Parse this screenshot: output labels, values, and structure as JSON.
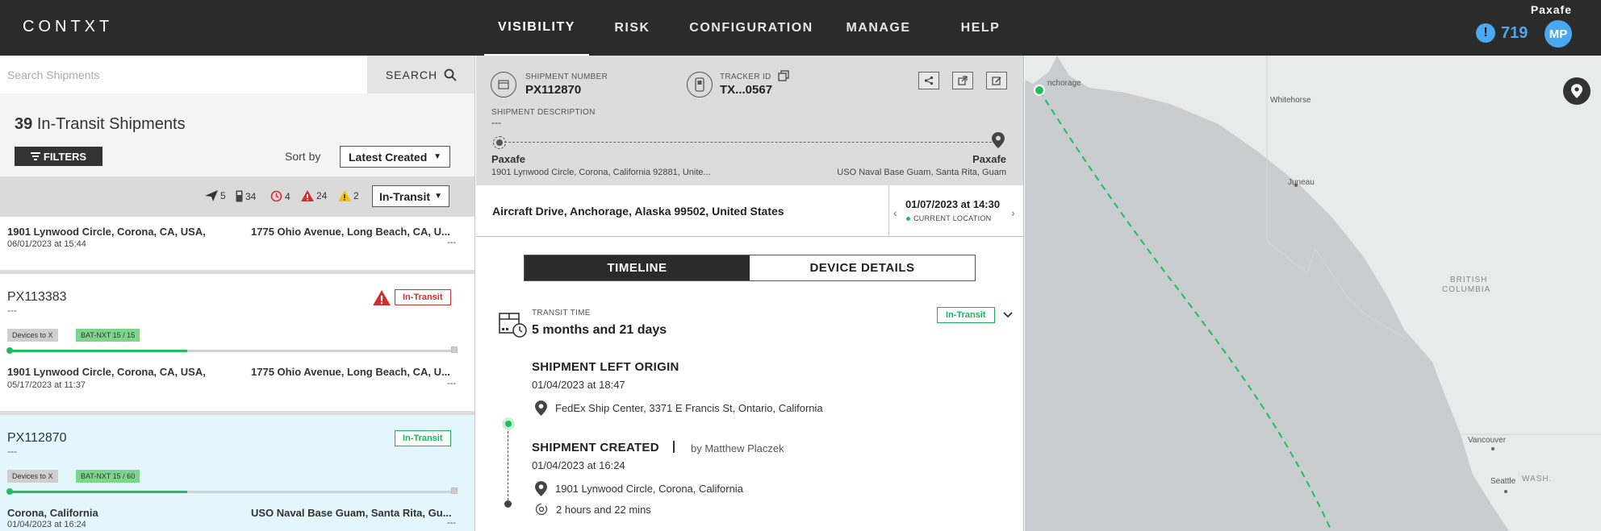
{
  "app": {
    "logo": "CONTXT",
    "org_name": "Paxafe",
    "alert_count": "719",
    "alert_icon": "exclamation-icon",
    "avatar_initials": "MP"
  },
  "nav": [
    {
      "label": "VISIBILITY",
      "active": true
    },
    {
      "label": "RISK",
      "active": false
    },
    {
      "label": "CONFIGURATION",
      "active": false
    },
    {
      "label": "MANAGE",
      "active": false
    },
    {
      "label": "HELP",
      "active": false
    }
  ],
  "search": {
    "placeholder": "Search Shipments",
    "button_label": "SEARCH"
  },
  "list": {
    "count": "39",
    "count_label": "In-Transit Shipments",
    "filters_label": "FILTERS",
    "sort_label": "Sort by",
    "sort_value": "Latest Created",
    "stats": {
      "in_flight": "5",
      "devices": "34",
      "late": "4",
      "alerts": "24",
      "warnings": "2"
    },
    "status_filter": "In-Transit",
    "cards": [
      {
        "origin": "1901 Lynwood Circle, Corona, CA, USA,",
        "destination": "1775 Ohio Avenue, Long Beach, CA, U...",
        "date": "06/01/2023 at 15:44",
        "dash": "---"
      },
      {
        "id": "PX113383",
        "desc": "---",
        "badge": "In-Transit",
        "chip1": "Devices to X",
        "chip2": "BAT-NXT 15 / 15",
        "progress": 0.4,
        "origin": "1901 Lynwood Circle, Corona, CA, USA,",
        "destination": "1775 Ohio Avenue, Long Beach, CA, U...",
        "date": "05/17/2023 at 11:37",
        "dash": "---"
      },
      {
        "id": "PX112870",
        "desc": "---",
        "badge": "In-Transit",
        "chip1": "Devices to X",
        "chip2": "BAT-NXT 15 / 60",
        "progress": 0.4,
        "origin": "Corona, California",
        "destination": "USO Naval Base Guam, Santa Rita, Gu...",
        "date": "01/04/2023 at 16:24",
        "dash": "---"
      }
    ]
  },
  "detail": {
    "shipment_number_label": "SHIPMENT NUMBER",
    "shipment_number": "PX112870",
    "tracker_label": "TRACKER ID",
    "tracker_id": "TX...0567",
    "description_label": "SHIPMENT DESCRIPTION",
    "description": "---",
    "origin_party": "Paxafe",
    "origin_address": "1901 Lynwood Circle, Corona, California 92881, Unite...",
    "dest_party": "Paxafe",
    "dest_address": "USO Naval Base Guam, Santa Rita, Guam",
    "current_location": "Aircraft Drive, Anchorage, Alaska 99502, United States",
    "current_time": "01/07/2023 at 14:30",
    "current_label": "CURRENT LOCATION",
    "tabs": [
      {
        "label": "TIMELINE",
        "active": true
      },
      {
        "label": "DEVICE DETAILS",
        "active": false
      }
    ],
    "transit_label": "TRANSIT TIME",
    "transit_value": "5 months and 21 days",
    "transit_badge": "In-Transit",
    "events": [
      {
        "title": "SHIPMENT LEFT ORIGIN",
        "date": "01/04/2023 at 18:47",
        "location": "FedEx Ship Center, 3371 E Francis St, Ontario, California"
      },
      {
        "title": "SHIPMENT CREATED",
        "by": "by Matthew Placzek",
        "date": "01/04/2023 at 16:24",
        "location": "1901 Lynwood Circle, Corona, California",
        "duration": "2 hours and 22 mins"
      }
    ]
  },
  "map": {
    "labels": {
      "anchorage": "nchorage",
      "whitehorse": "Whitehorse",
      "juneau": "Juneau",
      "bc1": "BRITISH",
      "bc2": "COLUMBIA",
      "vancouver": "Vancouver",
      "seattle": "Seattle",
      "wash": "WASH."
    },
    "colors": {
      "land": "#e9eaea",
      "water": "#c9cdcf",
      "route": "#1dbf5c"
    }
  }
}
